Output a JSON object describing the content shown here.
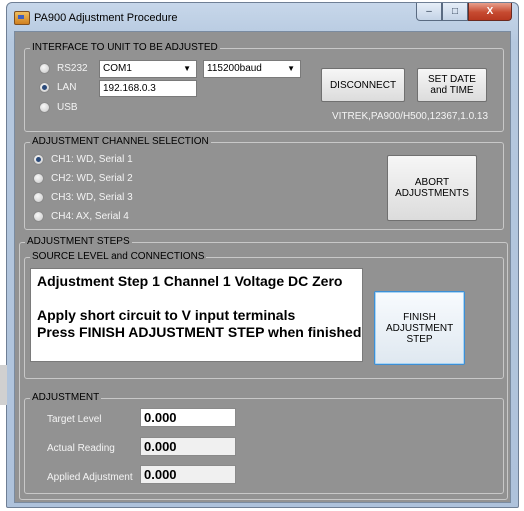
{
  "window": {
    "title": "PA900 Adjustment Procedure",
    "minimize_glyph": "–",
    "maximize_glyph": "□",
    "close_glyph": "X"
  },
  "interface": {
    "legend": "INTERFACE TO UNIT TO BE ADJUSTED",
    "options": [
      {
        "label": "RS232",
        "checked": false
      },
      {
        "label": "LAN",
        "checked": true
      },
      {
        "label": "USB",
        "checked": false
      }
    ],
    "port_value": "COM1",
    "baud_value": "115200baud",
    "ip_address": "192.168.0.3",
    "disconnect_label": "DISCONNECT",
    "set_date_label": "SET DATE and TIME",
    "device_id": "VITREK,PA900/H500,12367,1.0.13"
  },
  "channel_selection": {
    "legend": "ADJUSTMENT CHANNEL SELECTION",
    "channels": [
      {
        "label": "CH1: WD, Serial 1",
        "checked": true
      },
      {
        "label": "CH2: WD, Serial 2",
        "checked": false
      },
      {
        "label": "CH3: WD, Serial 3",
        "checked": false
      },
      {
        "label": "CH4: AX, Serial 4",
        "checked": false
      }
    ],
    "abort_label": "ABORT ADJUSTMENTS"
  },
  "steps": {
    "legend": "ADJUSTMENT STEPS",
    "source_legend": "SOURCE LEVEL and CONNECTIONS",
    "instructions": [
      "Adjustment Step 1 Channel 1 Voltage DC Zero",
      "",
      "Apply short circuit to V input terminals",
      "Press FINISH ADJUSTMENT STEP when finished"
    ],
    "finish_label": "FINISH ADJUSTMENT STEP"
  },
  "adjustment": {
    "legend": "ADJUSTMENT",
    "target_label": "Target Level",
    "target_value": "0.000",
    "actual_label": "Actual Reading",
    "actual_value": "0.000",
    "applied_label": "Applied Adjustment",
    "applied_value": "0.000"
  }
}
